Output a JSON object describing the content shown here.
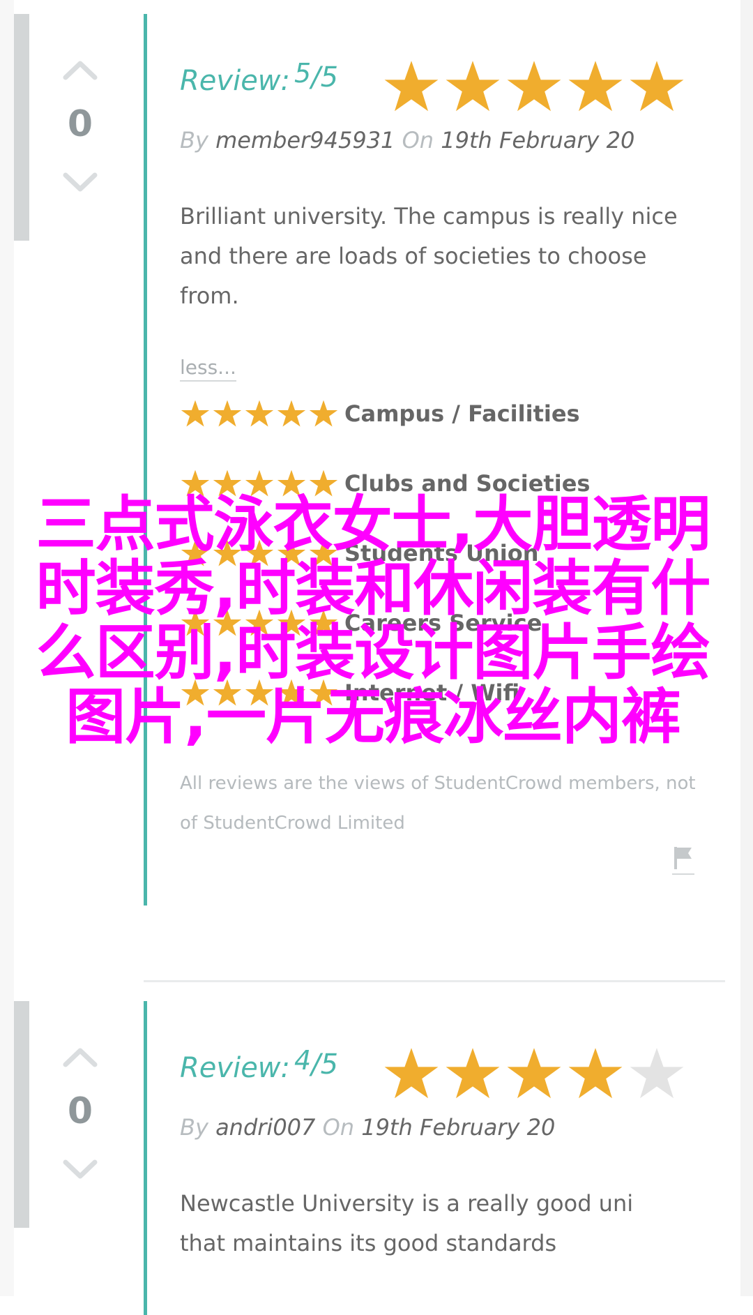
{
  "reviews": [
    {
      "votes": "0",
      "review_label": "Review:",
      "score": "5",
      "out_of": "/5",
      "rating": 5,
      "by_label": "By",
      "author": "member945931",
      "on_label": "On",
      "date": "19th February 20",
      "text": "Brilliant university. The campus is really nice and there are loads of societies to choose from.",
      "less_label": "less...",
      "categories": [
        {
          "name": "Campus / Facilities",
          "rating": 5
        },
        {
          "name": "Clubs and Societies",
          "rating": 5
        },
        {
          "name": "Students Union",
          "rating": 5
        },
        {
          "name": "Careers Service",
          "rating": 5
        },
        {
          "name": "Internet / Wifi",
          "rating": 5
        }
      ],
      "disclaimer": "All reviews are the views of StudentCrowd members, not of StudentCrowd Limited"
    },
    {
      "votes": "0",
      "review_label": "Review:",
      "score": "4",
      "out_of": "/5",
      "rating": 4,
      "by_label": "By",
      "author": "andri007",
      "on_label": "On",
      "date": "19th February 20",
      "text": "Newcastle University is a really good uni that maintains its good standards"
    }
  ],
  "overlay": "三点式泳衣女士,大胆透明时装秀,时装和休闲装有什么区别,时装设计图片手绘图片,一片无痕冰丝内裤",
  "colors": {
    "accent": "#4ab6ab",
    "star_filled": "#f0ad2e",
    "star_empty": "#e3e3e3",
    "overlay": "#ff00ff"
  },
  "icons": [
    "chevron-up-icon",
    "chevron-down-icon",
    "star-icon",
    "flag-icon"
  ]
}
